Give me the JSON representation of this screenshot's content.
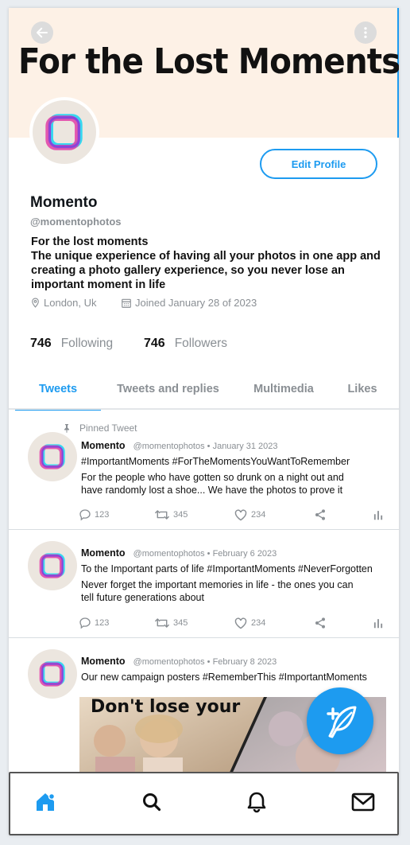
{
  "banner": {
    "title": "For the Lost Moments"
  },
  "profile": {
    "edit_label": "Edit Profile",
    "name": "Momento",
    "handle": "@momentophotos",
    "bio_line1": "For the lost moments",
    "bio_line2": "The unique experience of having all your photos in one app and creating a photo gallery experience, so you never lose an important moment in life",
    "location": "London, Uk",
    "joined": "Joined January 28 of 2023",
    "following_count": "746",
    "following_label": "Following",
    "followers_count": "746",
    "followers_label": "Followers"
  },
  "tabs": [
    {
      "label": "Tweets"
    },
    {
      "label": "Tweets and replies"
    },
    {
      "label": "Multimedia"
    },
    {
      "label": "Likes"
    }
  ],
  "tweets": [
    {
      "pinned_label": "Pinned Tweet",
      "name": "Momento",
      "meta": "@momentophotos • January 31 2023",
      "tags": "#ImportantMoments #ForTheMomentsYouWantToRemember",
      "body": "For the people who have gotten so drunk on a night out and have randomly lost a shoe... We have the photos to prove it",
      "replies": "123",
      "retweets": "345",
      "likes": "234"
    },
    {
      "name": "Momento",
      "meta": "@momentophotos • February 6 2023",
      "tags": "To the Important parts of life #ImportantMoments #NeverForgotten",
      "body": "Never forget the important memories in life - the ones you can tell future generations about",
      "replies": "123",
      "retweets": "345",
      "likes": "234"
    },
    {
      "name": "Momento",
      "meta": "@momentophotos • February 8 2023",
      "tags": "Our new campaign posters #RememberThis #ImportantMoments",
      "poster_text": "Don't lose your"
    }
  ],
  "colors": {
    "accent": "#1d9bf0",
    "banner": "#fdf1e6",
    "muted": "#8a8f94"
  }
}
